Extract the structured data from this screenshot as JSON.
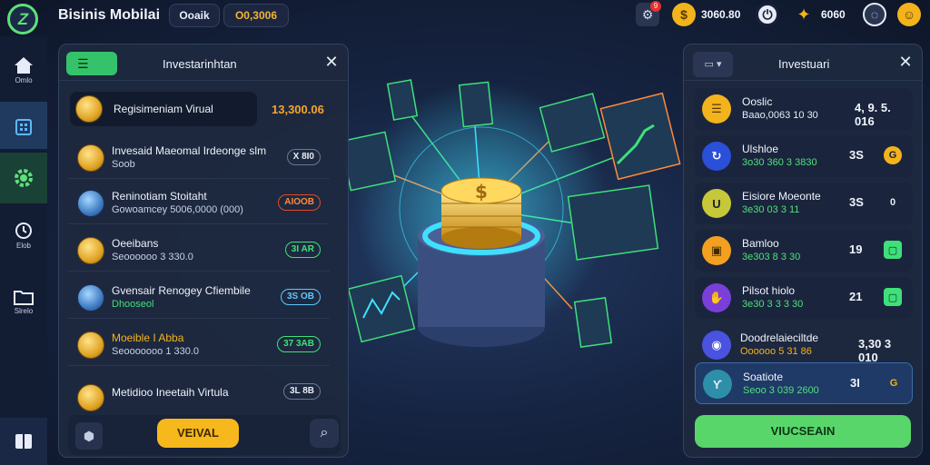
{
  "header": {
    "app_title": "Bisinis Mobilai",
    "pill_left": "Ooaik",
    "pill_right": "O0,3006",
    "coins": "3060.80",
    "gems": "6060",
    "notification_count": "9"
  },
  "leftnav": {
    "items": [
      {
        "label": "Omlo"
      },
      {
        "label": ""
      },
      {
        "label": ""
      },
      {
        "label": "Elob"
      },
      {
        "label": "Slrelo"
      },
      {
        "label": ""
      }
    ]
  },
  "left_panel": {
    "tab_label": "",
    "title": "Investarinhtan",
    "featured": {
      "name": "Regisimeniam Virual",
      "value": "13,300.06"
    },
    "rows": [
      {
        "name": "Invesaid Maeomal Irdeonge slm",
        "sub": "Soob",
        "tag": "X 8I0"
      },
      {
        "name": "Reninotiam Stoitaht",
        "sub": "Gowoamcey 5006,0000 (000)",
        "tag": "AIOOB"
      },
      {
        "name": "Oeeibans",
        "sub": "Seoooooo 3 330.0",
        "tag": "3I AR"
      },
      {
        "name": "Gvensair Renogey Cfiembile",
        "sub": "Dhooseol",
        "tag": "3S OB"
      },
      {
        "name": "Moeible I Abba",
        "sub": "Seooooooo 1 330.0",
        "tag": "37 3AB"
      },
      {
        "name": "Metidioo Ineetaih Virtula",
        "sub": "",
        "tag": "3L 8B"
      }
    ],
    "cta_label": "VEIVAL",
    "accent": "#f6b81c"
  },
  "right_panel": {
    "title": "Investuari",
    "rows": [
      {
        "name": "Ooslic",
        "sub": "Baao,0063 10 30",
        "value": "4, 9. 5. 016"
      },
      {
        "name": "Ulshloe",
        "sub": "3o30 360 3 3830",
        "value": "3S"
      },
      {
        "name": "Eisiore Moeonte",
        "sub": "3e30 03 3 11",
        "value": "3S"
      },
      {
        "name": "Bamloo",
        "sub": "3e303 8 3 30",
        "value": "19"
      },
      {
        "name": "Pilsot hiolo",
        "sub": "3e30 3 3 3 30",
        "value": "21"
      },
      {
        "name": "Doodrelaieciltde",
        "sub": "Oooooo 5 31 86",
        "value": "3,30 3 010"
      },
      {
        "name": "Soatiote",
        "sub": "Seoo 3 039 2600",
        "value": "3I"
      }
    ],
    "cta_label": "VIUCSEAIN",
    "accent": "#58d66a"
  }
}
